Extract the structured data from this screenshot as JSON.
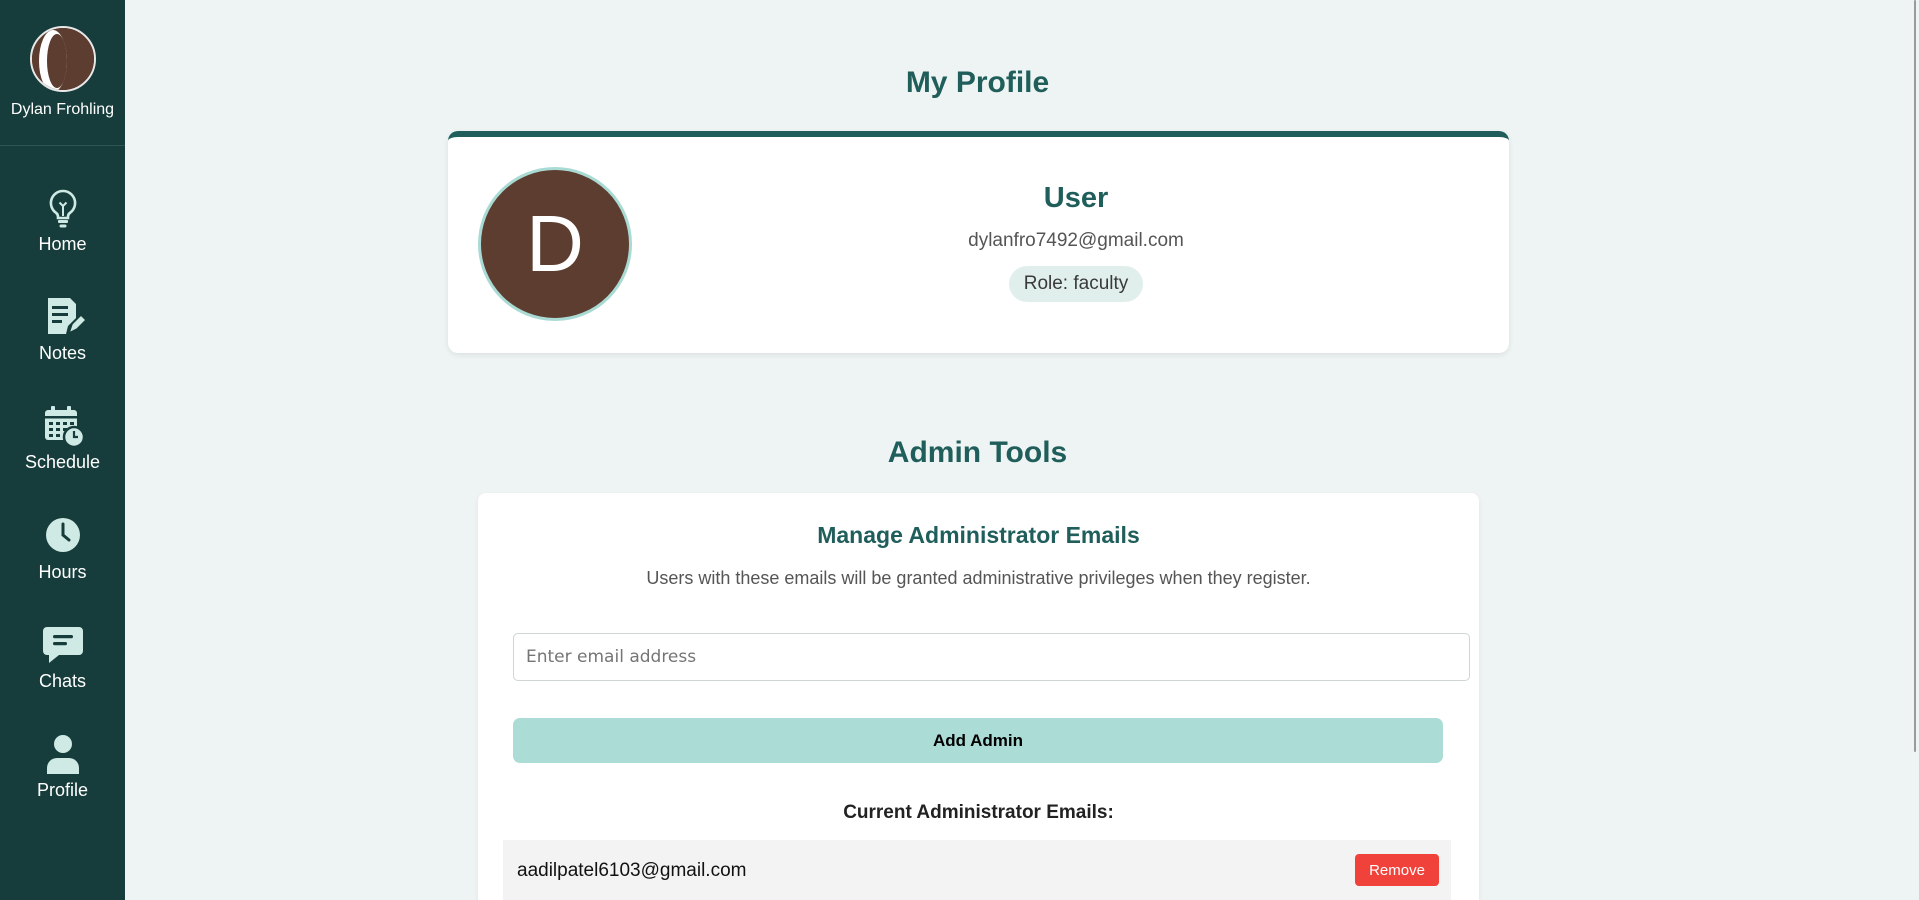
{
  "sidebar": {
    "user_name": "Dylan Frohling",
    "items": [
      {
        "label": "Home",
        "icon": "lightbulb-icon"
      },
      {
        "label": "Notes",
        "icon": "notes-edit-icon"
      },
      {
        "label": "Schedule",
        "icon": "calendar-clock-icon"
      },
      {
        "label": "Hours",
        "icon": "clock-icon"
      },
      {
        "label": "Chats",
        "icon": "chat-bubble-icon"
      },
      {
        "label": "Profile",
        "icon": "user-icon"
      }
    ]
  },
  "profile": {
    "title": "My Profile",
    "avatar_letter": "D",
    "name": "User",
    "email": "dylanfro7492@gmail.com",
    "role": "Role: faculty"
  },
  "admin_tools": {
    "title": "Admin Tools",
    "card_title": "Manage Administrator Emails",
    "description": "Users with these emails will be granted administrative privileges when they register.",
    "input_placeholder": "Enter email address",
    "add_button": "Add Admin",
    "list_heading": "Current Administrator Emails:",
    "admins": [
      {
        "email": "aadilpatel6103@gmail.com",
        "action": "Remove"
      }
    ]
  },
  "colors": {
    "sidebar_bg": "#163d3b",
    "accent": "#1f5e5a",
    "avatar_bg": "#5c3d30",
    "button_teal": "#acdcd6",
    "danger": "#f0423a"
  }
}
